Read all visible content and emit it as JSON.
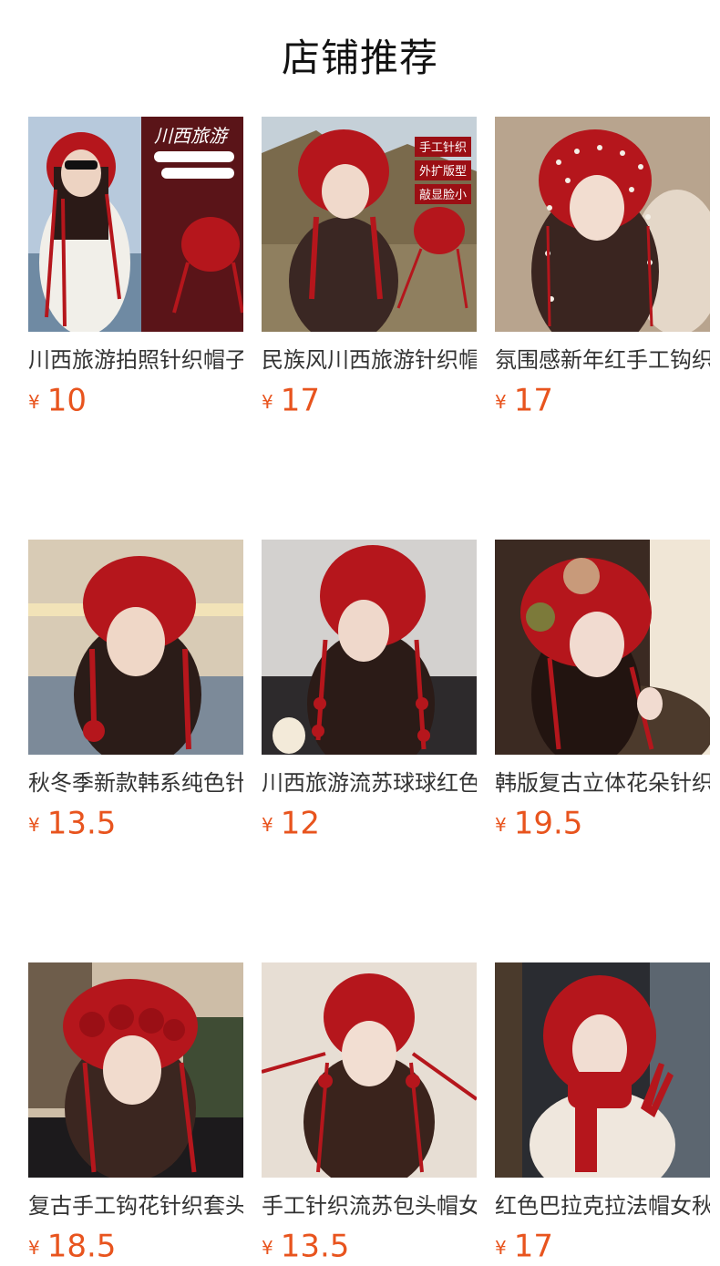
{
  "page": {
    "title": "店铺推荐"
  },
  "products": [
    {
      "name": "川西旅游拍照针织帽子女",
      "currency": "¥",
      "price": "10",
      "image": "red crochet hood with tassels, banner image",
      "banner_lines": [
        "川西旅游"
      ],
      "badges": []
    },
    {
      "name": "民族风川西旅游针织帽女",
      "currency": "¥",
      "price": "17",
      "image": "red knit hood with tassels",
      "banner_lines": [],
      "badges": [
        "手工针织",
        "外扩版型",
        "敲显脸小"
      ]
    },
    {
      "name": "氛围感新年红手工钩织帽",
      "currency": "¥",
      "price": "17",
      "image": "red hood with pearl beads",
      "banner_lines": [],
      "badges": []
    },
    {
      "name": "秋冬季新款韩系纯色针织",
      "currency": "¥",
      "price": "13.5",
      "image": "red knit bonnet with pom ties",
      "banner_lines": [],
      "badges": []
    },
    {
      "name": "川西旅游流苏球球红色帽",
      "currency": "¥",
      "price": "12",
      "image": "red knit hood with ball tassels",
      "banner_lines": [],
      "badges": []
    },
    {
      "name": "韩版复古立体花朵针织帽",
      "currency": "¥",
      "price": "19.5",
      "image": "red crochet hat with flowers",
      "banner_lines": [],
      "badges": []
    },
    {
      "name": "复古手工钩花针织套头帽",
      "currency": "¥",
      "price": "18.5",
      "image": "red crochet flower hat",
      "banner_lines": [],
      "badges": []
    },
    {
      "name": "手工针织流苏包头帽女冬",
      "currency": "¥",
      "price": "13.5",
      "image": "red knit hood with long tassels",
      "banner_lines": [],
      "badges": []
    },
    {
      "name": "红色巴拉克拉法帽女秋冬",
      "currency": "¥",
      "price": "17",
      "image": "red balaclava hood with scarf",
      "banner_lines": [],
      "badges": []
    }
  ],
  "colors": {
    "price": "#e8541e",
    "text": "#333333",
    "hat_red": "#b5161c"
  }
}
